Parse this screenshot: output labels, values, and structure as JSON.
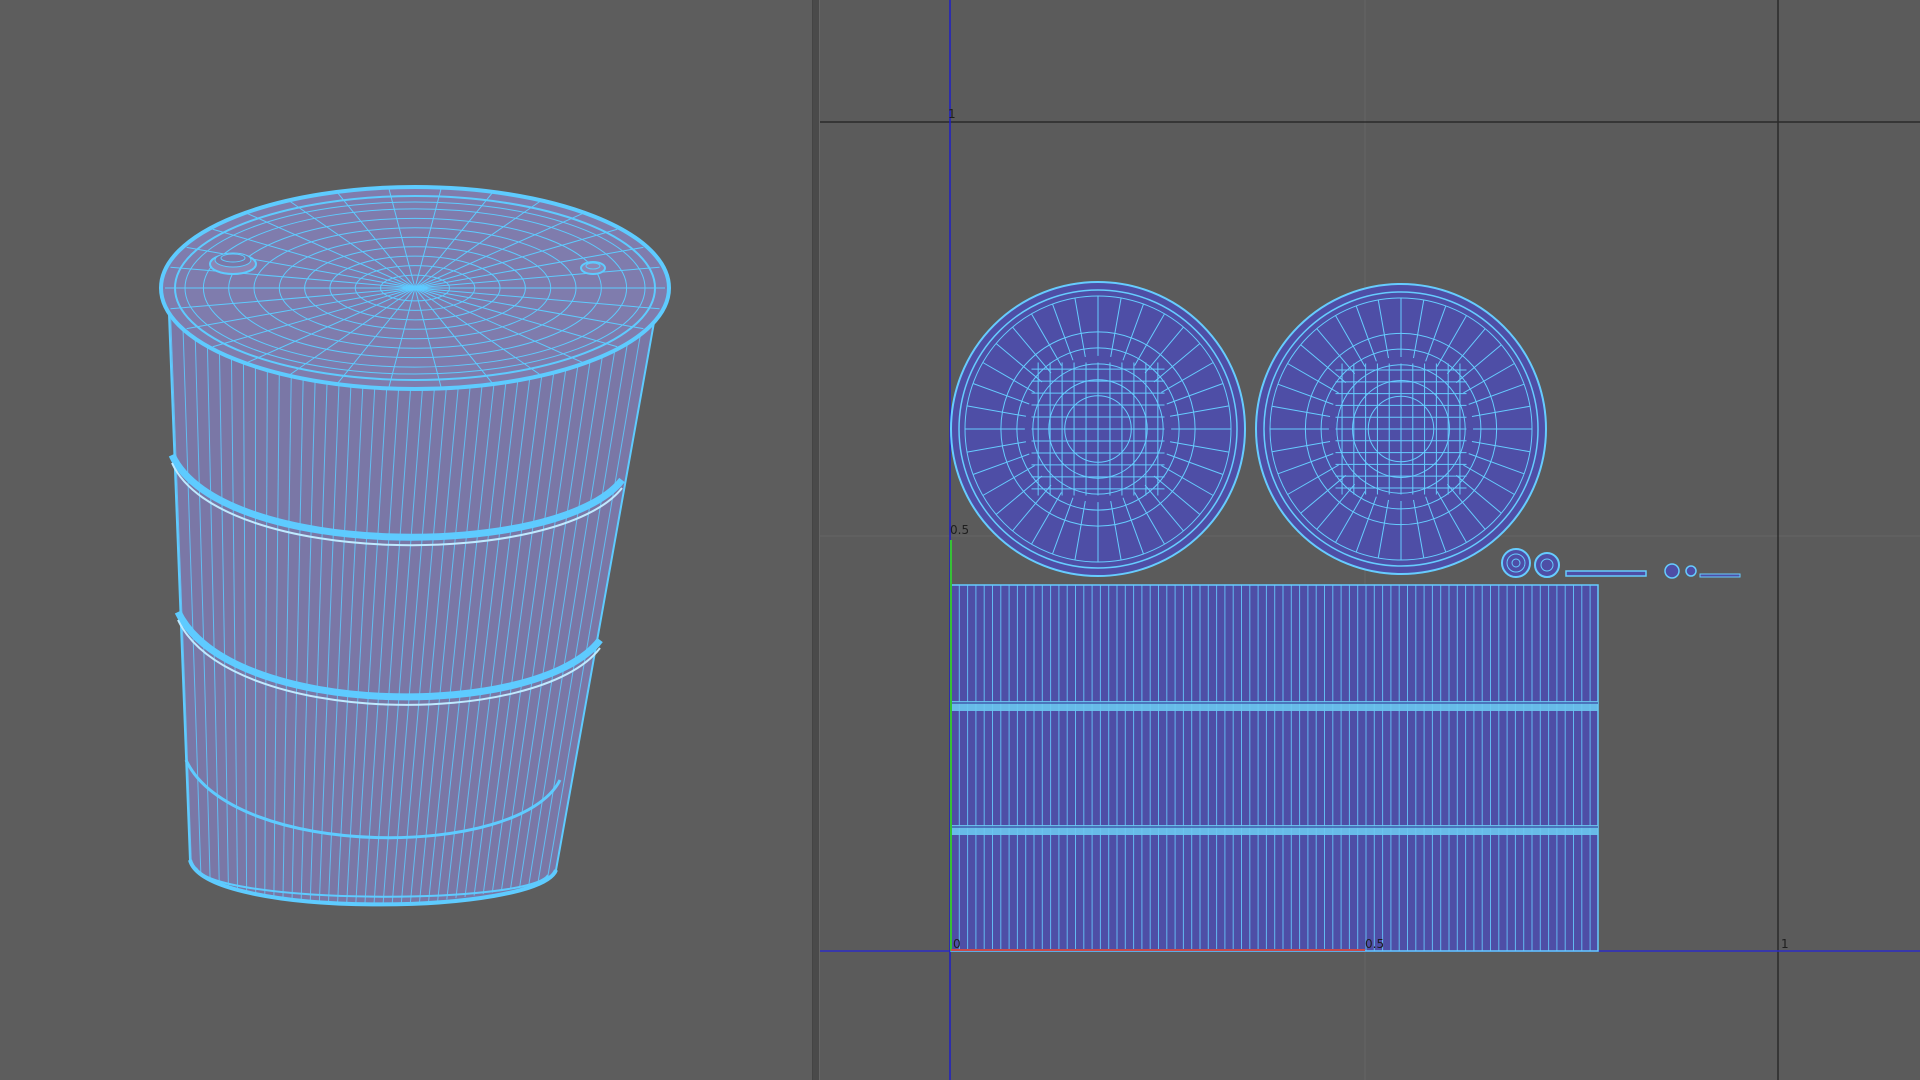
{
  "viewport_3d": {
    "object": "barrel-mesh",
    "wire_color": "#5ecbff",
    "surface_color": "#7b78a8"
  },
  "uv_editor": {
    "labels": {
      "v_top": "1",
      "v_mid": "0.5",
      "origin": "0",
      "u_mid": "0.5",
      "u_right": "1"
    },
    "colors": {
      "background": "#5b5b5b",
      "grid": "#6a6a6a",
      "border": "#2a2a2a",
      "u_axis": "#2d2dc4",
      "v_axis": "#1e1ec8",
      "green_axis": "#36c136",
      "red_axis": "#c84a4a",
      "shell_fill": "#4f4fa8",
      "shell_wire": "#66ccff"
    }
  }
}
